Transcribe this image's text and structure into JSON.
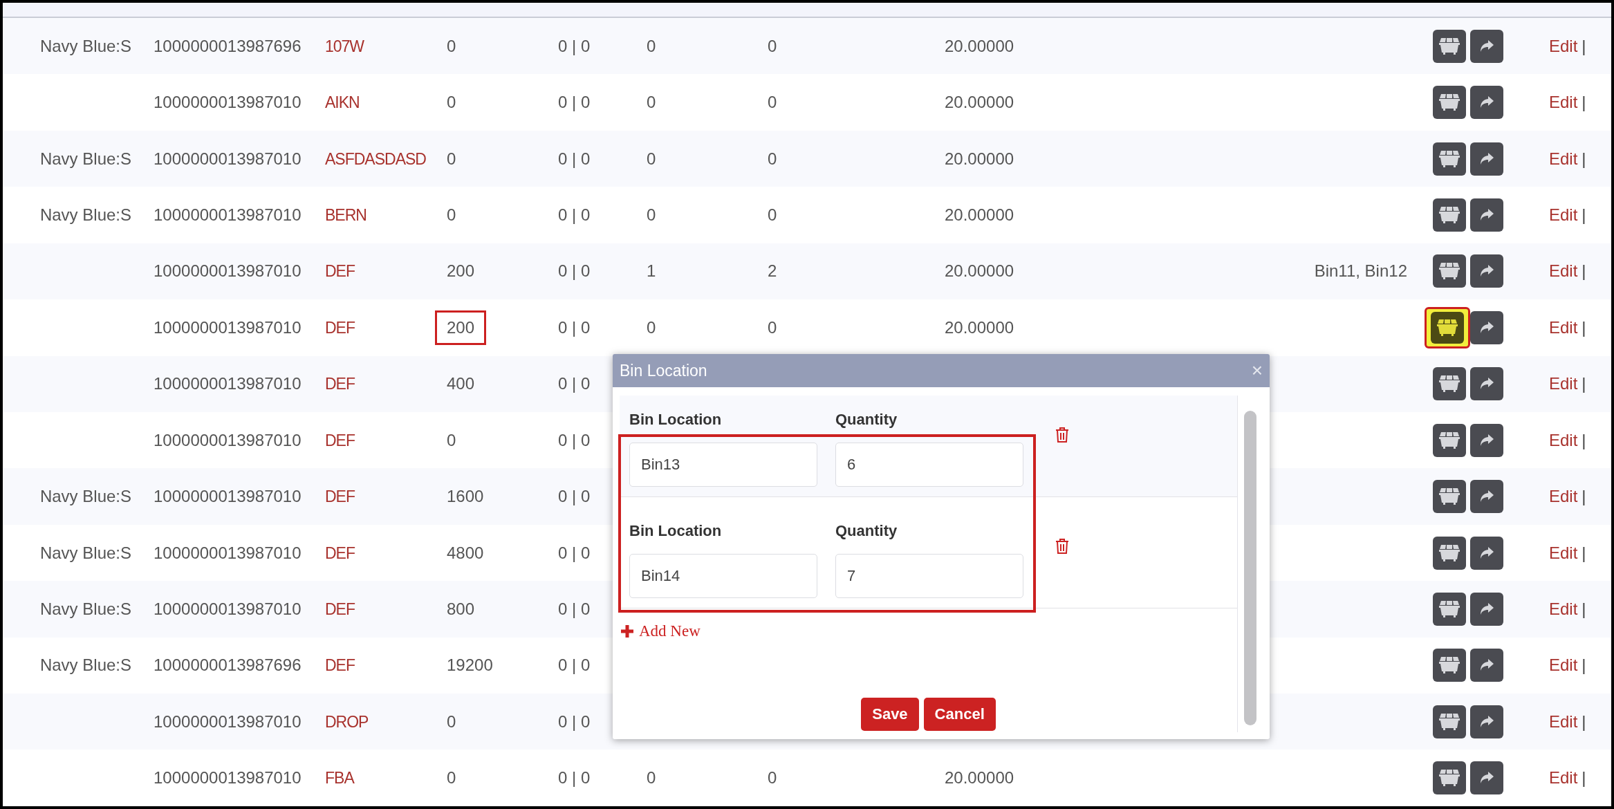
{
  "rows": [
    {
      "column_1": "Navy Blue:S",
      "column_2": "1000000013987696",
      "column_3": "107W",
      "column_4": "0",
      "column_5": "0 | 0",
      "column_6": "0",
      "column_7": "0",
      "column_8": "20.00000",
      "quantity_highlighted": false,
      "bin_button_highlighted": false,
      "edit": "Edit",
      "separator": "|"
    },
    {
      "column_2": "1000000013987010",
      "column_3": "AIKN",
      "column_4": "0",
      "column_5": "0 | 0",
      "column_6": "0",
      "column_7": "0",
      "column_8": "20.00000",
      "quantity_highlighted": false,
      "bin_button_highlighted": false,
      "edit": "Edit",
      "separator": "|"
    },
    {
      "column_1": "Navy Blue:S",
      "column_2": "1000000013987010",
      "column_3": "ASFDASDASD",
      "column_4": "0",
      "column_5": "0 | 0",
      "column_6": "0",
      "column_7": "0",
      "column_8": "20.00000",
      "quantity_highlighted": false,
      "bin_button_highlighted": false,
      "edit": "Edit",
      "separator": "|"
    },
    {
      "column_1": "Navy Blue:S",
      "column_2": "1000000013987010",
      "column_3": "BERN",
      "column_4": "0",
      "column_5": "0 | 0",
      "column_6": "0",
      "column_7": "0",
      "column_8": "20.00000",
      "quantity_highlighted": false,
      "bin_button_highlighted": false,
      "edit": "Edit",
      "separator": "|"
    },
    {
      "column_2": "1000000013987010",
      "column_3": "DEF",
      "column_4": "200",
      "column_5": "0 | 0",
      "column_6": "1",
      "column_7": "2",
      "column_8": "20.00000",
      "column_9": "Bin11, Bin12",
      "quantity_highlighted": false,
      "bin_button_highlighted": false,
      "edit": "Edit",
      "separator": "|"
    },
    {
      "column_2": "1000000013987010",
      "column_3": "DEF",
      "column_4": "200",
      "column_5": "0 | 0",
      "column_6": "0",
      "column_7": "0",
      "column_8": "20.00000",
      "quantity_highlighted": true,
      "bin_button_highlighted": true,
      "edit": "Edit",
      "separator": "|"
    },
    {
      "column_2": "1000000013987010",
      "column_3": "DEF",
      "column_4": "400",
      "column_5": "0 | 0",
      "quantity_highlighted": false,
      "bin_button_highlighted": false,
      "edit": "Edit",
      "separator": "|"
    },
    {
      "column_2": "1000000013987010",
      "column_3": "DEF",
      "column_4": "0",
      "column_5": "0 | 0",
      "quantity_highlighted": false,
      "bin_button_highlighted": false,
      "edit": "Edit",
      "separator": "|"
    },
    {
      "column_1": "Navy Blue:S",
      "column_2": "1000000013987010",
      "column_3": "DEF",
      "column_4": "1600",
      "column_5": "0 | 0",
      "quantity_highlighted": false,
      "bin_button_highlighted": false,
      "edit": "Edit",
      "separator": "|"
    },
    {
      "column_1": "Navy Blue:S",
      "column_2": "1000000013987010",
      "column_3": "DEF",
      "column_4": "4800",
      "column_5": "0 | 0",
      "quantity_highlighted": false,
      "bin_button_highlighted": false,
      "edit": "Edit",
      "separator": "|"
    },
    {
      "column_1": "Navy Blue:S",
      "column_2": "1000000013987010",
      "column_3": "DEF",
      "column_4": "800",
      "column_5": "0 | 0",
      "quantity_highlighted": false,
      "bin_button_highlighted": false,
      "edit": "Edit",
      "separator": "|"
    },
    {
      "column_1": "Navy Blue:S",
      "column_2": "1000000013987696",
      "column_3": "DEF",
      "column_4": "19200",
      "column_5": "0 | 0",
      "quantity_highlighted": false,
      "bin_button_highlighted": false,
      "edit": "Edit",
      "separator": "|"
    },
    {
      "column_2": "1000000013987010",
      "column_3": "DROP",
      "column_4": "0",
      "column_5": "0 | 0",
      "quantity_highlighted": false,
      "bin_button_highlighted": false,
      "edit": "Edit",
      "separator": "|"
    },
    {
      "column_2": "1000000013987010",
      "column_3": "FBA",
      "column_4": "0",
      "column_5": "0 | 0",
      "column_6": "0",
      "column_7": "0",
      "column_8": "20.00000",
      "quantity_highlighted": false,
      "bin_button_highlighted": false,
      "edit": "Edit",
      "separator": "|"
    }
  ],
  "dialog": {
    "title": "Bin Location",
    "close": "×",
    "entries_highlighted": true,
    "entries": [
      {
        "location_label": "Bin Location",
        "quantity_label": "Quantity",
        "location": "Bin13",
        "quantity": "6"
      },
      {
        "location_label": "Bin Location",
        "quantity_label": "Quantity",
        "location": "Bin14",
        "quantity": "7"
      }
    ],
    "add_new": "Add New",
    "save": "Save",
    "cancel": "Cancel"
  }
}
